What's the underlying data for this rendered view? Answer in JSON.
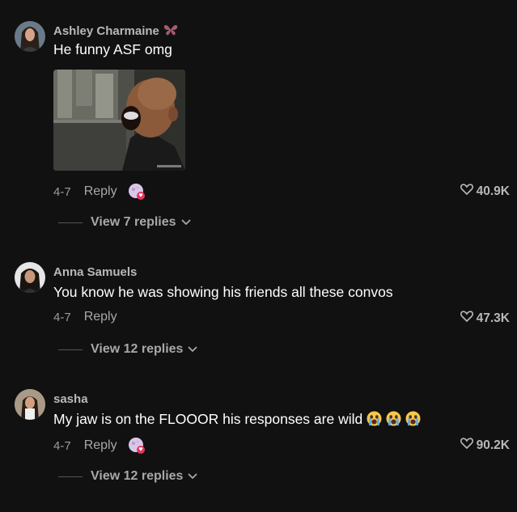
{
  "comments": [
    {
      "username": "Ashley Charmaine",
      "text": "He funny ASF omg",
      "date": "4-7",
      "reply_label": "Reply",
      "likes": "40.9K",
      "view_replies": "View 7 replies",
      "has_gif": true,
      "has_sticker": true,
      "username_icon": "butterfly-icon"
    },
    {
      "username": "Anna Samuels",
      "text": "You know he was showing his friends all these convos",
      "date": "4-7",
      "reply_label": "Reply",
      "likes": "47.3K",
      "view_replies": "View 12 replies",
      "has_gif": false,
      "has_sticker": false
    },
    {
      "username": "sasha",
      "text": "My jaw is on the FLOOOR his responses are wild",
      "emojis": [
        "crying-face-icon",
        "crying-face-icon",
        "crying-face-icon"
      ],
      "date": "4-7",
      "reply_label": "Reply",
      "likes": "90.2K",
      "view_replies": "View 12 replies",
      "has_gif": false,
      "has_sticker": true
    }
  ],
  "colors": {
    "background": "#111111",
    "text": "#ffffff",
    "muted": "#9a9a9a",
    "username": "#b8b8b8",
    "sticker_badge": "#e8345c"
  }
}
